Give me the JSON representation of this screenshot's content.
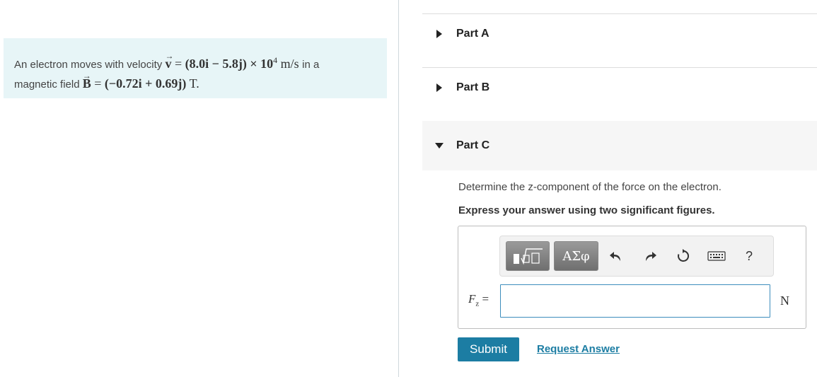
{
  "problem": {
    "line1_text": "An electron moves with velocity",
    "v_symbol": "v",
    "arrow": "⃗",
    "equals": " = ",
    "v_expr": "(8.0i − 5.8j) × 10",
    "v_exp": "4",
    "v_unit": " m/s",
    "line1_tail": "in a",
    "line2_text": "magnetic field",
    "b_symbol": "B",
    "b_expr": "(−0.72i + 0.69j)",
    "b_unit": " T."
  },
  "parts": [
    {
      "label": "Part A",
      "expanded": false
    },
    {
      "label": "Part B",
      "expanded": false
    },
    {
      "label": "Part C",
      "expanded": true
    }
  ],
  "part_c": {
    "prompt": "Determine the z-component of the force on the electron.",
    "instruction": "Express your answer using two significant figures.",
    "var_letter": "F",
    "var_sub": "z",
    "var_eq": " =",
    "input_value": "",
    "unit": "N",
    "toolbar": {
      "greek_label": "ΑΣφ",
      "help_label": "?"
    },
    "submit_label": "Submit",
    "request_label": "Request Answer"
  },
  "colors": {
    "problem_bg": "#e7f5f7",
    "accent": "#1c7da3",
    "input_border": "#3c8dbc"
  }
}
